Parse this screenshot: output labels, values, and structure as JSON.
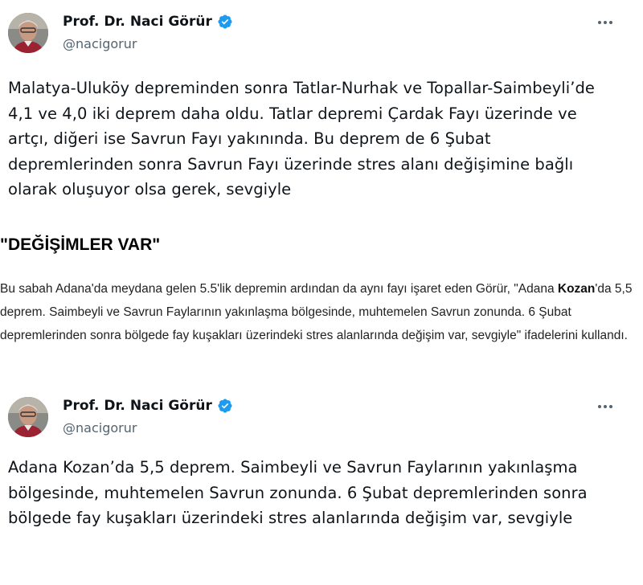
{
  "tweets": [
    {
      "author": {
        "display_name": "Prof. Dr. Naci Görür",
        "handle": "@nacigorur",
        "verified_icon": "verified-badge-icon",
        "avatar": "profile-photo"
      },
      "text": "Malatya-Uluköy depreminden sonra Tatlar-Nurhak ve Topallar-Saimbeyli’de 4,1 ve 4,0 iki deprem daha oldu. Tatlar depremi Çardak Fayı üzerinde ve artçı, diğeri ise Savrun Fayı yakınında. Bu deprem de 6 Şubat depremlerinden sonra Savrun Fayı üzerinde stres alanı değişimine bağlı olarak oluşuyor olsa gerek, sevgiyle"
    },
    {
      "author": {
        "display_name": "Prof. Dr. Naci Görür",
        "handle": "@nacigorur",
        "verified_icon": "verified-badge-icon",
        "avatar": "profile-photo"
      },
      "text": "Adana Kozan’da 5,5 deprem. Saimbeyli ve Savrun Faylarının yakınlaşma bölgesinde, muhtemelen Savrun zonunda. 6 Şubat depremlerinden sonra bölgede fay kuşakları üzerindeki stres alanlarında değişim var, sevgiyle"
    }
  ],
  "article": {
    "heading": "\"DEĞİŞİMLER VAR\"",
    "paragraph_before_bold": "Bu sabah Adana'da meydana gelen 5.5'lik depremin ardından da aynı fayı işaret eden Görür, \"Adana ",
    "paragraph_bold": "Kozan",
    "paragraph_after_bold": "'da 5,5 deprem. Saimbeyli ve Savrun Faylarının yakınlaşma bölgesinde, muhtemelen Savrun zonunda. 6 Şubat depremlerinden sonra bölgede fay kuşakları üzerindeki stres alanlarında değişim var, sevgiyle\" ifadelerini kullandı."
  },
  "colors": {
    "text_primary": "#0f1419",
    "text_secondary": "#536471",
    "verified_blue": "#1d9bf0",
    "article_text": "#222222"
  }
}
